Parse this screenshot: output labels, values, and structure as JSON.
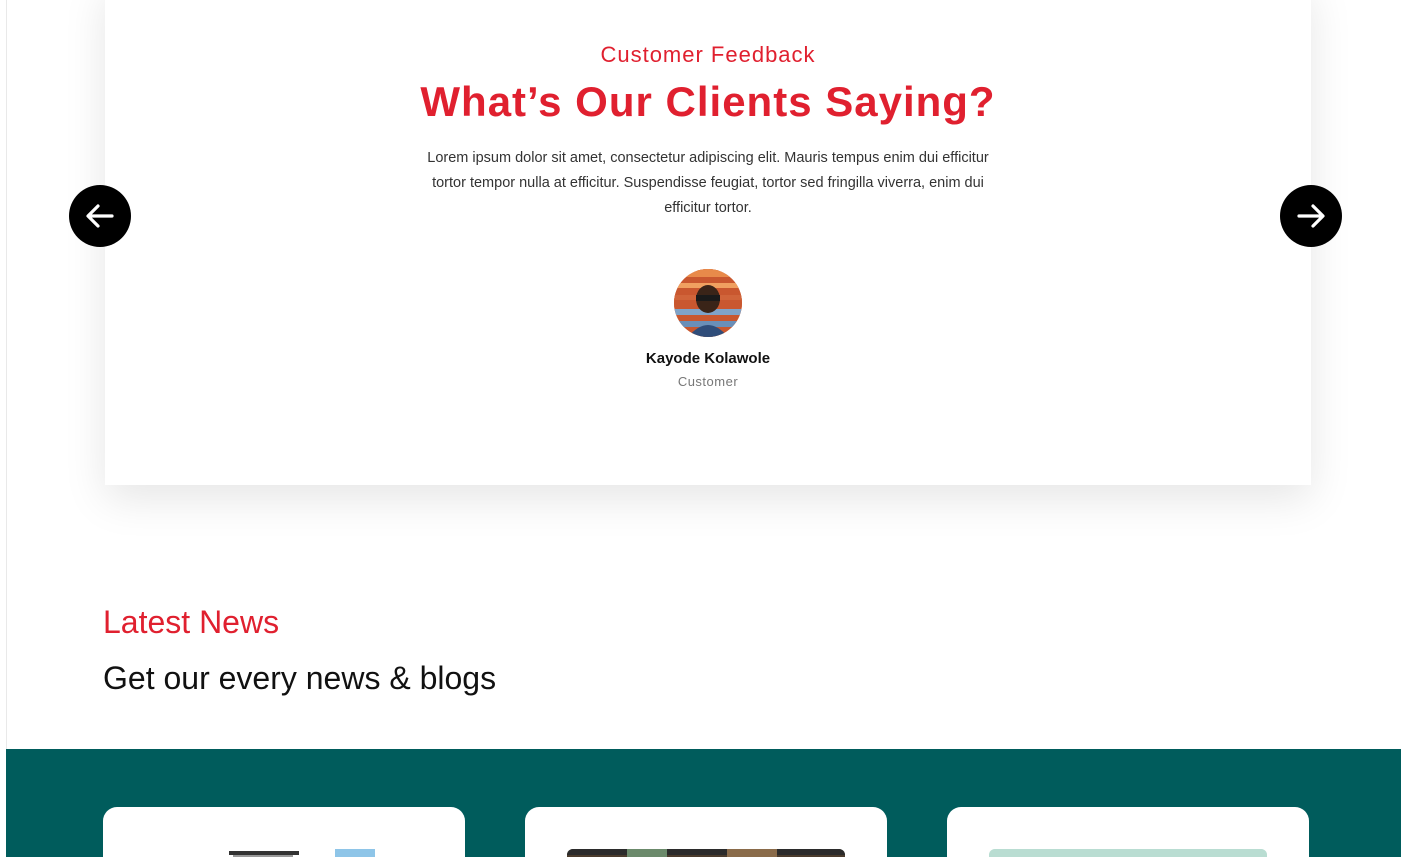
{
  "testimonials": {
    "eyebrow": "Customer Feedback",
    "headline": "What’s Our Clients Saying?",
    "quote": "Lorem ipsum dolor sit amet, consectetur adipiscing elit. Mauris tempus enim dui efficitur tortor tempor nulla at efficitur. Suspendisse feugiat, tortor sed fringilla viverra, enim dui efficitur tortor.",
    "author_name": "Kayode Kolawole",
    "author_role": "Customer",
    "prev_icon": "arrow-left-icon",
    "next_icon": "arrow-right-icon"
  },
  "news": {
    "eyebrow": "Latest News",
    "title": "Get our every news & blogs",
    "cards": [
      {
        "id": "news-card-1"
      },
      {
        "id": "news-card-2"
      },
      {
        "id": "news-card-3"
      }
    ]
  },
  "colors": {
    "accent_red": "#e0202f",
    "teal_band": "#005c5c",
    "arrow_bg": "#000000"
  }
}
